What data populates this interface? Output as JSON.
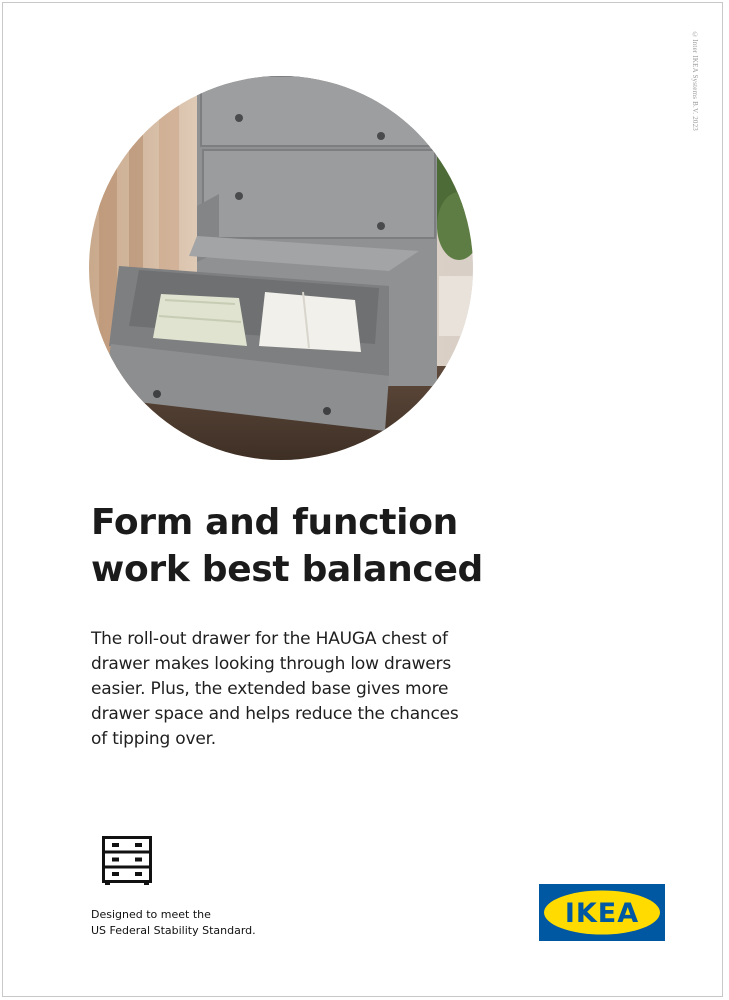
{
  "copyright": "©Inter IKEA Systems B.V. 2023",
  "headline": {
    "lines": [
      "Form and function",
      "work best balanced"
    ]
  },
  "body": {
    "lines": [
      "The roll-out drawer for the HAUGA chest of",
      "drawer makes looking through low drawers",
      "easier. Plus, the extended base gives more",
      "drawer space and helps reduce the chances",
      "of tipping over."
    ]
  },
  "stability_note": {
    "lines": [
      "Designed to meet the",
      "US Federal Stability Standard."
    ]
  },
  "icons": {
    "product_icon": "chest-of-drawers-icon"
  },
  "logo": {
    "text": "IKEA",
    "colors": {
      "blue": "#0058a3",
      "yellow": "#ffdb00"
    }
  },
  "photo": {
    "subject": "grey chest of drawers with roll-out drawer holding folded baby clothes"
  }
}
